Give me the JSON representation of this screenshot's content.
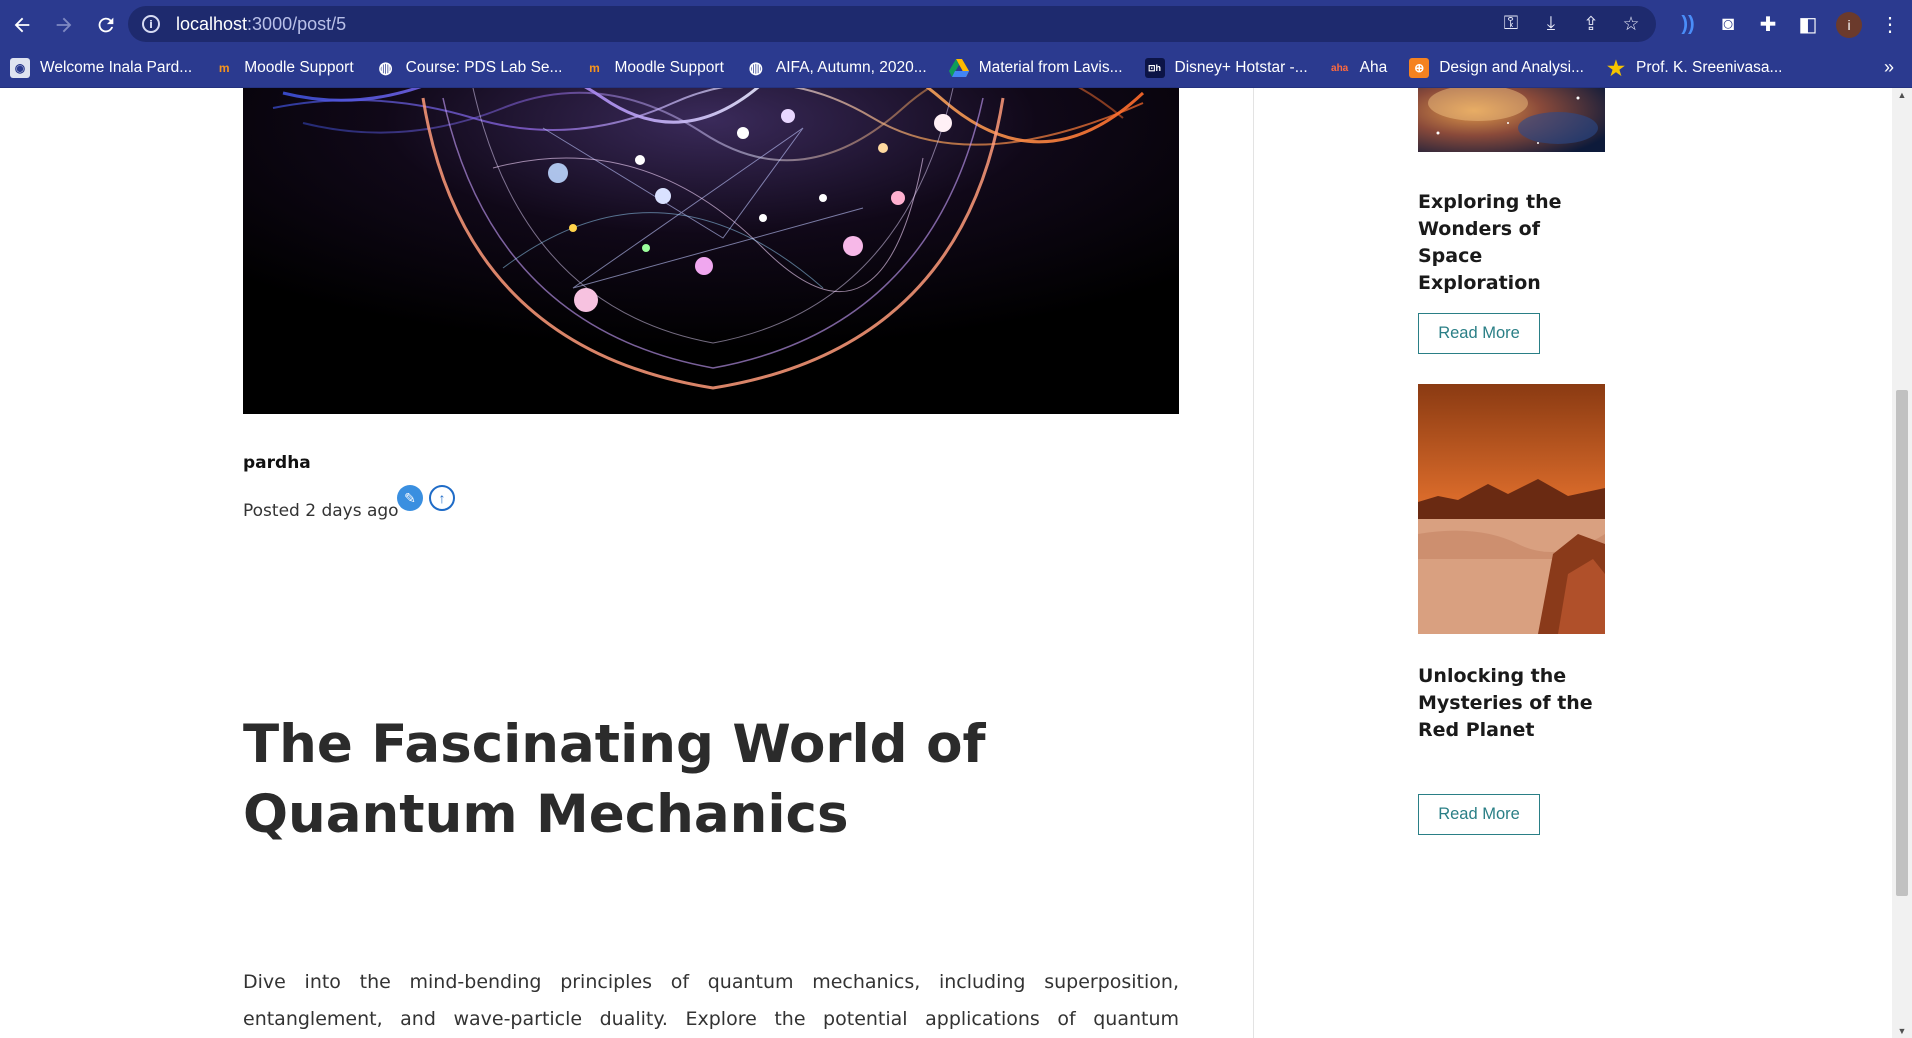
{
  "browser": {
    "url_host": "localhost",
    "url_path": ":3000/post/5",
    "bookmarks": [
      {
        "label": "Welcome Inala Pard...",
        "icon": "moodle-user-icon"
      },
      {
        "label": "Moodle Support",
        "icon": "moodle-icon"
      },
      {
        "label": "Course: PDS Lab Se...",
        "icon": "globe-icon"
      },
      {
        "label": "Moodle Support",
        "icon": "moodle-icon"
      },
      {
        "label": "AIFA, Autumn, 2020...",
        "icon": "globe-icon"
      },
      {
        "label": "Material from Lavis...",
        "icon": "google-drive-icon"
      },
      {
        "label": "Disney+ Hotstar -...",
        "icon": "hotstar-icon"
      },
      {
        "label": "Aha",
        "icon": "aha-icon"
      },
      {
        "label": "Design and Analysi...",
        "icon": "codechef-icon"
      },
      {
        "label": "Prof. K. Sreenivasa...",
        "icon": "star-icon"
      }
    ],
    "more_bookmarks": "»"
  },
  "post": {
    "author": "pardha",
    "posted": "Posted 2 days ago",
    "title": "The Fascinating World of Quantum Mechanics",
    "body": "Dive into the mind-bending principles of quantum mechanics, including superposition, entanglement, and wave-particle duality. Explore the potential applications of quantum technology and how it may revolutionize computing, cryptography, and communication."
  },
  "sidebar": {
    "cards": [
      {
        "title": "Exploring the Wonders of Space Exploration",
        "button": "Read More"
      },
      {
        "title": "Unlocking the Mysteries of the Red Planet",
        "button": "Read More"
      }
    ]
  },
  "colors": {
    "chrome": "#2b3a8f",
    "omnibox": "#1e2a6e",
    "button_accent": "#2a7f86"
  }
}
